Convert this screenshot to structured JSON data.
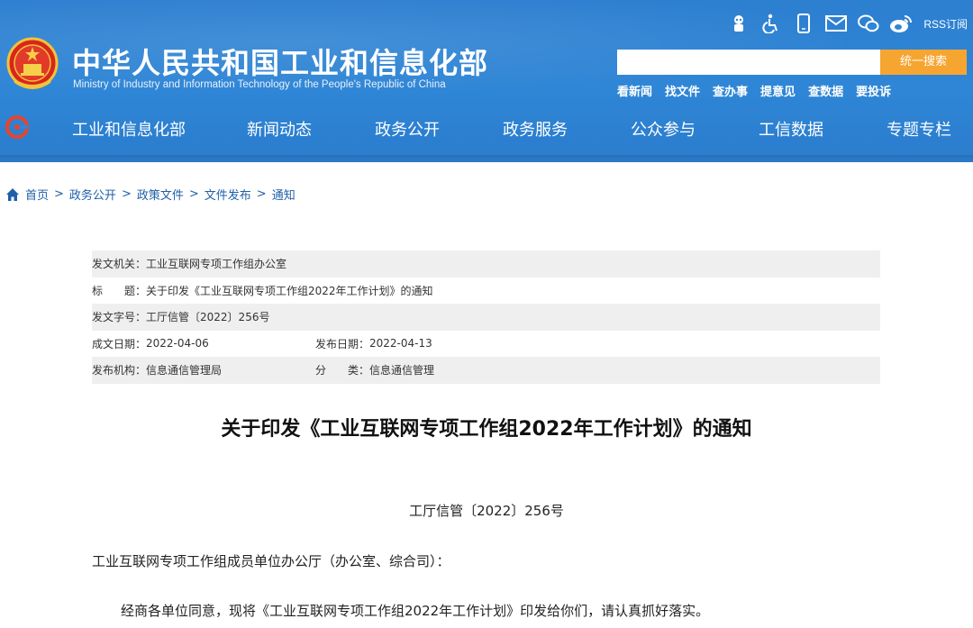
{
  "header": {
    "title": "中华人民共和国工业和信息化部",
    "subtitle": "Ministry of Industry and Information Technology of the People's Republic of China",
    "tools": {
      "rss_label": "RSS订阅",
      "icons": [
        "robot-icon",
        "accessibility-icon",
        "mobile-icon",
        "mail-icon",
        "wechat-icon",
        "weibo-icon"
      ]
    },
    "search": {
      "placeholder": "",
      "button_label": "统一搜索"
    },
    "quick_links": [
      "看新闻",
      "找文件",
      "查办事",
      "提意见",
      "查数据",
      "要投诉"
    ],
    "accent_color": "#f6a531",
    "brand_color": "#2f86d6"
  },
  "nav": {
    "items": [
      "工业和信息化部",
      "新闻动态",
      "政务公开",
      "政务服务",
      "公众参与",
      "工信数据",
      "专题专栏"
    ]
  },
  "breadcrumb": [
    "首页",
    "政务公开",
    "政策文件",
    "文件发布",
    "通知"
  ],
  "info": {
    "issuer_label": "发文机关：",
    "issuer": "工业互联网专项工作组办公室",
    "title_label": "标　　题：",
    "title": "关于印发《工业互联网专项工作组2022年工作计划》的通知",
    "docno_label": "发文字号：",
    "docno": "工厅信管〔2022〕256号",
    "written_label": "成文日期：",
    "written": "2022-04-06",
    "published_label": "发布日期：",
    "published": "2022-04-13",
    "org_label": "发布机构：",
    "org": "信息通信管理局",
    "category_label": "分　　类：",
    "category": "信息通信管理"
  },
  "article": {
    "title": "关于印发《工业互联网专项工作组2022年工作计划》的通知",
    "number": "工厅信管〔2022〕256号",
    "addressee": "工业互联网专项工作组成员单位办公厅（办公室、综合司）：",
    "paragraph1": "经商各单位同意，现将《工业互联网专项工作组2022年工作计划》印发给你们，请认真抓好落实。"
  }
}
